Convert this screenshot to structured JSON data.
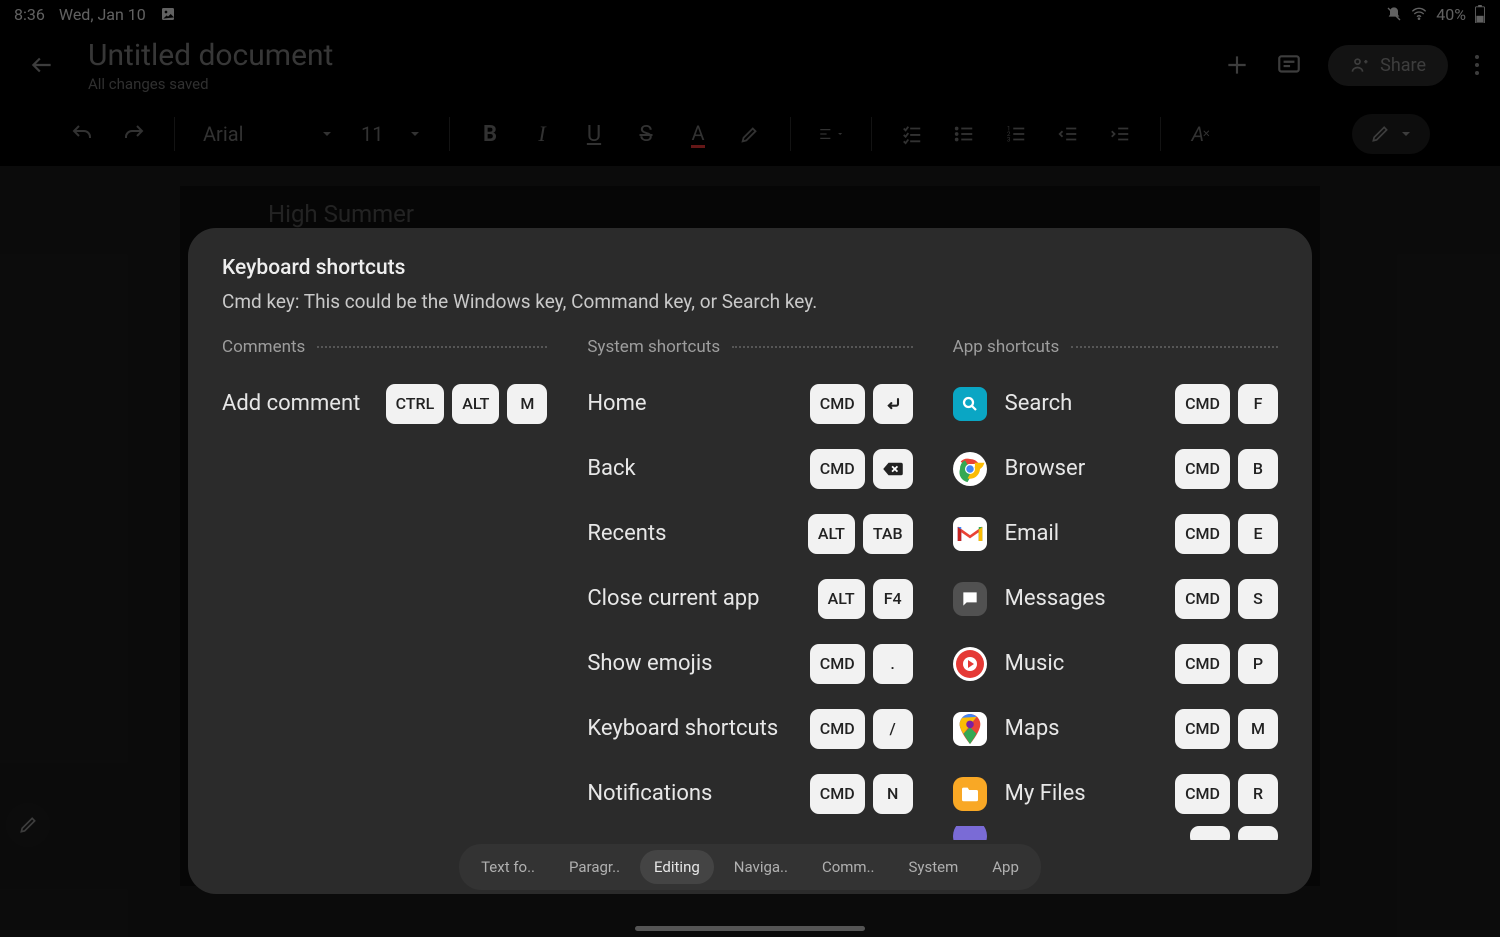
{
  "status": {
    "time": "8:36",
    "date": "Wed, Jan 10",
    "battery": "40%"
  },
  "header": {
    "title": "Untitled document",
    "subtitle": "All changes saved",
    "share": "Share"
  },
  "toolbar": {
    "font": "Arial",
    "size": "11"
  },
  "page": {
    "snippet": "High Summer"
  },
  "dialog": {
    "title": "Keyboard shortcuts",
    "subtitle": "Cmd key: This could be the Windows key, Command key, or Search key.",
    "sections": {
      "comments": {
        "title": "Comments",
        "rows": [
          {
            "label": "Add comment",
            "keys": [
              "CTRL",
              "ALT",
              "M"
            ]
          }
        ]
      },
      "system": {
        "title": "System shortcuts",
        "rows": [
          {
            "label": "Home",
            "keys": [
              "CMD",
              "enter-icon"
            ]
          },
          {
            "label": "Back",
            "keys": [
              "CMD",
              "backspace-icon"
            ]
          },
          {
            "label": "Recents",
            "keys": [
              "ALT",
              "TAB"
            ]
          },
          {
            "label": "Close current app",
            "keys": [
              "ALT",
              "F4"
            ]
          },
          {
            "label": "Show emojis",
            "keys": [
              "CMD",
              "."
            ]
          },
          {
            "label": "Keyboard shortcuts",
            "keys": [
              "CMD",
              "/"
            ]
          },
          {
            "label": "Notifications",
            "keys": [
              "CMD",
              "N"
            ]
          }
        ]
      },
      "app": {
        "title": "App shortcuts",
        "rows": [
          {
            "label": "Search",
            "icon": "search",
            "keys": [
              "CMD",
              "F"
            ]
          },
          {
            "label": "Browser",
            "icon": "chrome",
            "keys": [
              "CMD",
              "B"
            ]
          },
          {
            "label": "Email",
            "icon": "gmail",
            "keys": [
              "CMD",
              "E"
            ]
          },
          {
            "label": "Messages",
            "icon": "messages",
            "keys": [
              "CMD",
              "S"
            ]
          },
          {
            "label": "Music",
            "icon": "music",
            "keys": [
              "CMD",
              "P"
            ]
          },
          {
            "label": "Maps",
            "icon": "maps",
            "keys": [
              "CMD",
              "M"
            ]
          },
          {
            "label": "My Files",
            "icon": "files",
            "keys": [
              "CMD",
              "R"
            ]
          }
        ]
      }
    },
    "tabs": [
      {
        "label": "Text fo..",
        "active": false
      },
      {
        "label": "Paragr..",
        "active": false
      },
      {
        "label": "Editing",
        "active": true
      },
      {
        "label": "Naviga..",
        "active": false
      },
      {
        "label": "Comm..",
        "active": false
      },
      {
        "label": "System",
        "active": false
      },
      {
        "label": "App",
        "active": false
      }
    ]
  }
}
